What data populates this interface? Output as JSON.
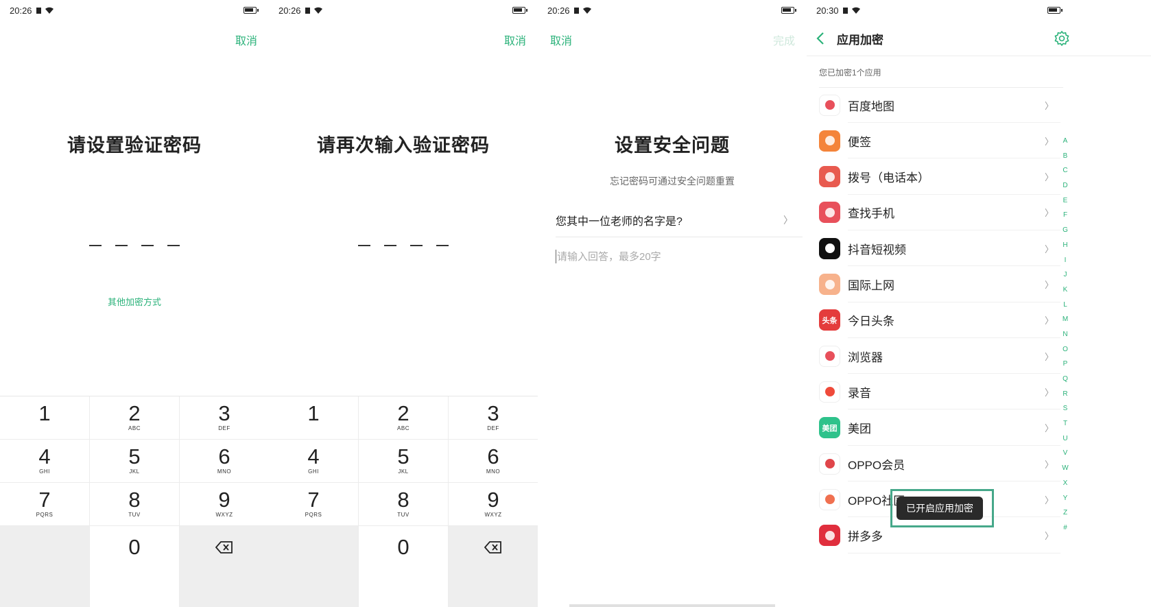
{
  "screens": [
    {
      "status_time": "20:26",
      "top_action": "取消",
      "title": "请设置验证密码",
      "alt_link": "其他加密方式"
    },
    {
      "status_time": "20:26",
      "top_action": "取消",
      "title": "请再次输入验证密码"
    },
    {
      "status_time": "20:26",
      "cancel": "取消",
      "done": "完成",
      "title": "设置安全问题",
      "subtitle": "忘记密码可通过安全问题重置",
      "question": "您其中一位老师的名字是?",
      "answer_placeholder": "请输入回答，最多20字"
    },
    {
      "status_time": "20:30",
      "title": "应用加密",
      "count_text": "您已加密1个应用",
      "apps": [
        {
          "name": "百度地图",
          "icon": "baidu-map-icon",
          "color": "#ffffff"
        },
        {
          "name": "便签",
          "icon": "notes-icon",
          "color": "#f4843a"
        },
        {
          "name": "拨号（电话本）",
          "icon": "phone-contacts-icon",
          "color": "#e85a4f"
        },
        {
          "name": "查找手机",
          "icon": "find-phone-icon",
          "color": "#e8505b"
        },
        {
          "name": "抖音短视频",
          "icon": "douyin-icon",
          "color": "#111111"
        },
        {
          "name": "国际上网",
          "icon": "global-internet-icon",
          "color": "#f7b28c"
        },
        {
          "name": "今日头条",
          "icon": "toutiao-icon",
          "color": "#e43c3c",
          "label": "头条"
        },
        {
          "name": "浏览器",
          "icon": "browser-icon",
          "color": "#ffffff"
        },
        {
          "name": "录音",
          "icon": "recorder-icon",
          "color": "#ffffff"
        },
        {
          "name": "美团",
          "icon": "meituan-icon",
          "color": "#2ec28b",
          "label": "美团"
        },
        {
          "name": "OPPO会员",
          "icon": "oppo-member-icon",
          "color": "#ffffff"
        },
        {
          "name": "OPPO社区",
          "icon": "oppo-community-icon",
          "color": "#ffffff"
        },
        {
          "name": "拼多多",
          "icon": "pinduoduo-icon",
          "color": "#e02e3d"
        }
      ],
      "alphabet": [
        "A",
        "B",
        "C",
        "D",
        "E",
        "F",
        "G",
        "H",
        "I",
        "J",
        "K",
        "L",
        "M",
        "N",
        "O",
        "P",
        "Q",
        "R",
        "S",
        "T",
        "U",
        "V",
        "W",
        "X",
        "Y",
        "Z",
        "#"
      ],
      "toast": "已开启应用加密"
    }
  ],
  "keypad": {
    "keys": [
      {
        "num": "1",
        "sub": ""
      },
      {
        "num": "2",
        "sub": "ABC"
      },
      {
        "num": "3",
        "sub": "DEF"
      },
      {
        "num": "4",
        "sub": "GHI"
      },
      {
        "num": "5",
        "sub": "JKL"
      },
      {
        "num": "6",
        "sub": "MNO"
      },
      {
        "num": "7",
        "sub": "PQRS"
      },
      {
        "num": "8",
        "sub": "TUV"
      },
      {
        "num": "9",
        "sub": "WXYZ"
      },
      {
        "num": "0",
        "sub": ""
      }
    ]
  },
  "colors": {
    "accent": "#2bb27a",
    "toast_border": "#46a88a"
  }
}
